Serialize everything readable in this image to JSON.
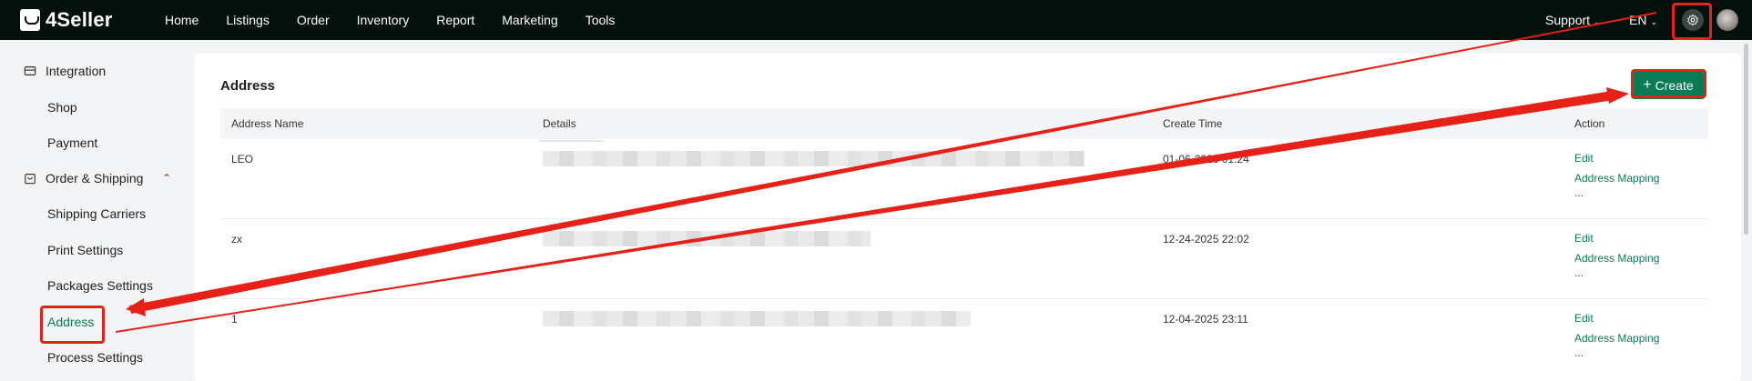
{
  "brand": {
    "name": "4Seller"
  },
  "nav": {
    "items": [
      "Home",
      "Listings",
      "Order",
      "Inventory",
      "Report",
      "Marketing",
      "Tools"
    ]
  },
  "header_right": {
    "support_label": "Support",
    "lang_label": "EN"
  },
  "sidebar": {
    "integration_label": "Integration",
    "shop_label": "Shop",
    "payment_label": "Payment",
    "order_shipping_label": "Order & Shipping",
    "shipping_carriers_label": "Shipping Carriers",
    "print_settings_label": "Print Settings",
    "packages_settings_label": "Packages Settings",
    "address_label": "Address",
    "process_settings_label": "Process Settings"
  },
  "page": {
    "title": "Address",
    "create_label": "Create"
  },
  "table": {
    "headers": {
      "name": "Address Name",
      "details": "Details",
      "create_time": "Create Time",
      "action": "Action"
    },
    "rows": [
      {
        "name": "LEO",
        "create_time": "01-06-2026 01:24",
        "edit": "Edit",
        "mapping": "Address Mapping",
        "more": "..."
      },
      {
        "name": "zx",
        "create_time": "12-24-2025 22:02",
        "edit": "Edit",
        "mapping": "Address Mapping",
        "more": "..."
      },
      {
        "name": "1",
        "create_time": "12-04-2025 23:11",
        "edit": "Edit",
        "mapping": "Address Mapping",
        "more": "..."
      }
    ]
  },
  "colors": {
    "topbar": "#03100c",
    "accent": "#0b7a56",
    "annotation": "#e62117"
  }
}
